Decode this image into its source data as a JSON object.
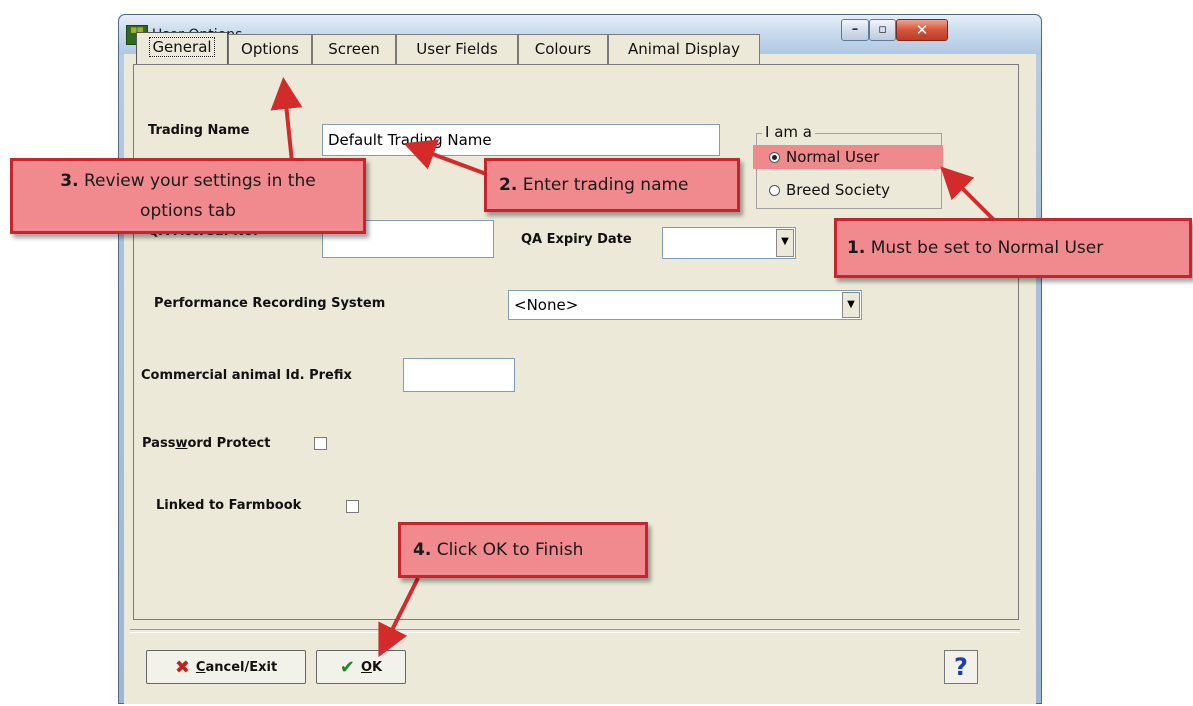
{
  "window": {
    "title": "User Options",
    "app_icon": "app-icon",
    "controls": [
      "minimize-icon",
      "maximize-icon",
      "close-icon"
    ]
  },
  "tabs": [
    {
      "label": "General",
      "selected": true
    },
    {
      "label": "Options"
    },
    {
      "label": "Screen"
    },
    {
      "label": "User Fields"
    },
    {
      "label": "Colours"
    },
    {
      "label": "Animal Display"
    }
  ],
  "form": {
    "trading_name_label": "Trading Name",
    "trading_name_value": "Default Trading Name",
    "qa_accred_label": "QA Accred. No.",
    "qa_accred_value": "",
    "qa_expiry_label": "QA Expiry Date",
    "qa_expiry_value": "",
    "perf_label": "Performance Recording System",
    "perf_value": "<None>",
    "prefix_label": "Commercial animal Id. Prefix",
    "prefix_value": "",
    "password_label_pre": "Pass",
    "password_label_ul": "w",
    "password_label_post": "ord Protect",
    "password_checked": false,
    "farmbook_label": "Linked to Farmbook",
    "farmbook_checked": false
  },
  "user_type": {
    "group_title": "I am a",
    "options": [
      {
        "label": "Normal User",
        "selected": true
      },
      {
        "label": "Breed Society",
        "selected": false
      }
    ]
  },
  "buttons": {
    "cancel_ul": "C",
    "cancel_rest": "ancel/Exit",
    "ok_ul": "O",
    "ok_rest": "K",
    "help": "?"
  },
  "callouts": {
    "c1_num": "1.",
    "c1_text": " Must be set to Normal User",
    "c2_num": "2.",
    "c2_text": " Enter trading name",
    "c3_num": "3.",
    "c3_text_a": " Review your settings in the",
    "c3_text_b": "options tab",
    "c4_num": "4.",
    "c4_text": " Click OK to Finish"
  },
  "colors": {
    "callout_fill": "#f08a8f",
    "callout_border": "#c7242b",
    "arrow": "#d42a2a",
    "dialog_bg": "#ece9d8"
  }
}
